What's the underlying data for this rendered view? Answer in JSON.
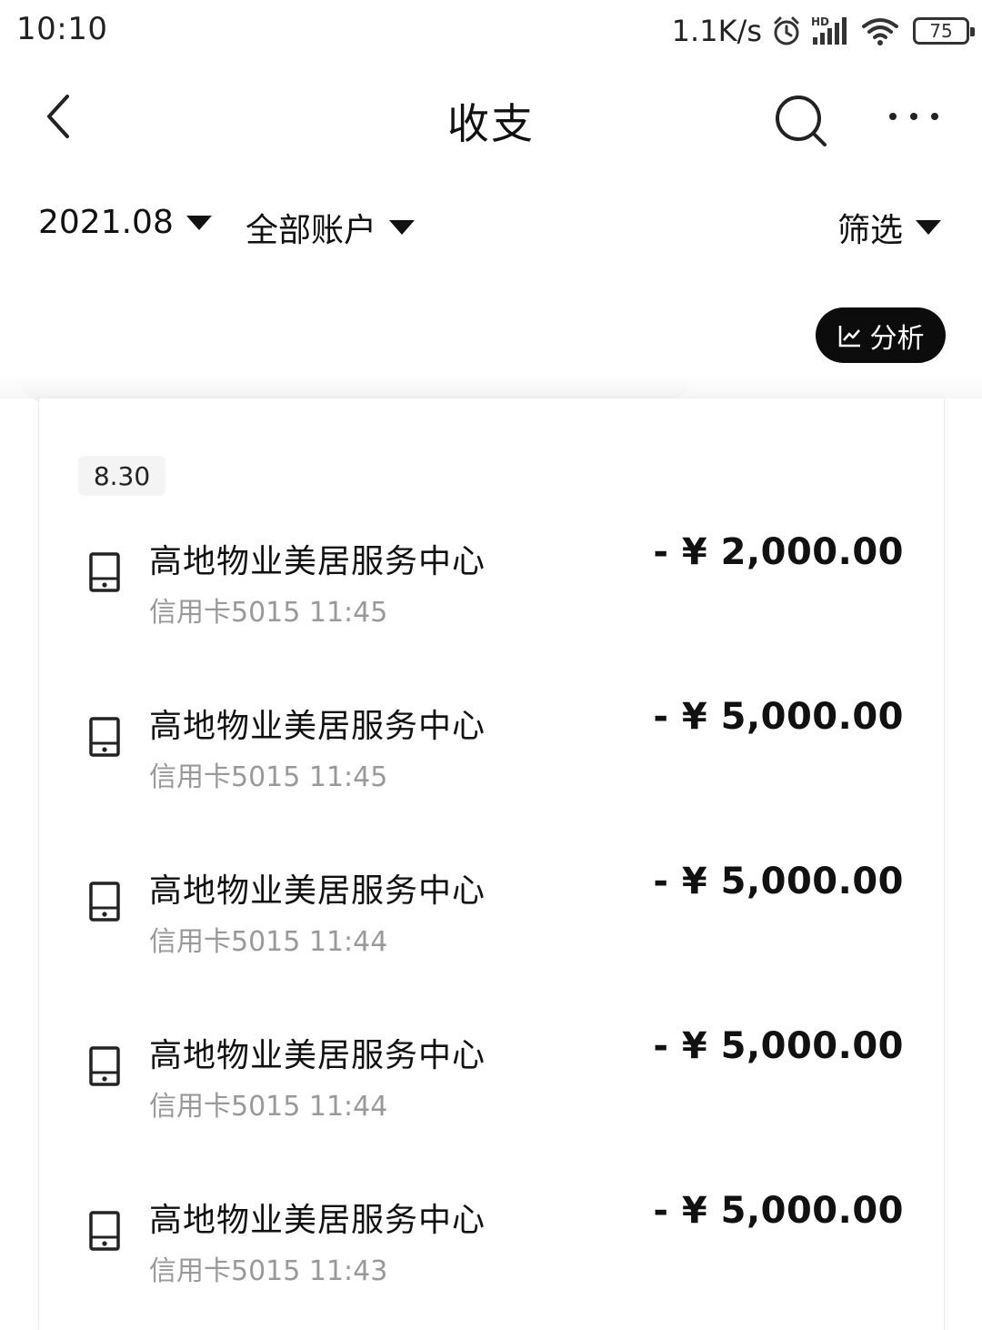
{
  "status_bar": {
    "time": "10:10",
    "net_speed": "1.1K/s",
    "battery": "75",
    "icons": [
      "alarm-icon",
      "hd-signal-icon",
      "wifi-icon",
      "battery-icon"
    ]
  },
  "nav": {
    "title": "收支",
    "icons": [
      "back-icon",
      "search-icon",
      "more-icon"
    ]
  },
  "filters": {
    "month": "2021.08",
    "account": "全部账户",
    "filter": "筛选"
  },
  "analysis_button": {
    "label": "分析",
    "icon": "chart-line-icon"
  },
  "list": {
    "date": "8.30",
    "transactions": [
      {
        "name": "高地物业美居服务中心",
        "sub": "信用卡5015 11:45",
        "amount": "- ¥ 2,000.00",
        "icon": "card-reader-icon"
      },
      {
        "name": "高地物业美居服务中心",
        "sub": "信用卡5015 11:45",
        "amount": "- ¥ 5,000.00",
        "icon": "card-reader-icon"
      },
      {
        "name": "高地物业美居服务中心",
        "sub": "信用卡5015 11:44",
        "amount": "- ¥ 5,000.00",
        "icon": "card-reader-icon"
      },
      {
        "name": "高地物业美居服务中心",
        "sub": "信用卡5015 11:44",
        "amount": "- ¥ 5,000.00",
        "icon": "card-reader-icon"
      },
      {
        "name": "高地物业美居服务中心",
        "sub": "信用卡5015 11:43",
        "amount": "- ¥ 5,000.00",
        "icon": "card-reader-icon"
      }
    ]
  },
  "colors": {
    "text_primary": "#111111",
    "text_secondary": "#999999",
    "button_dark": "#0c0c0c",
    "date_badge_bg": "#f4f4f4"
  }
}
